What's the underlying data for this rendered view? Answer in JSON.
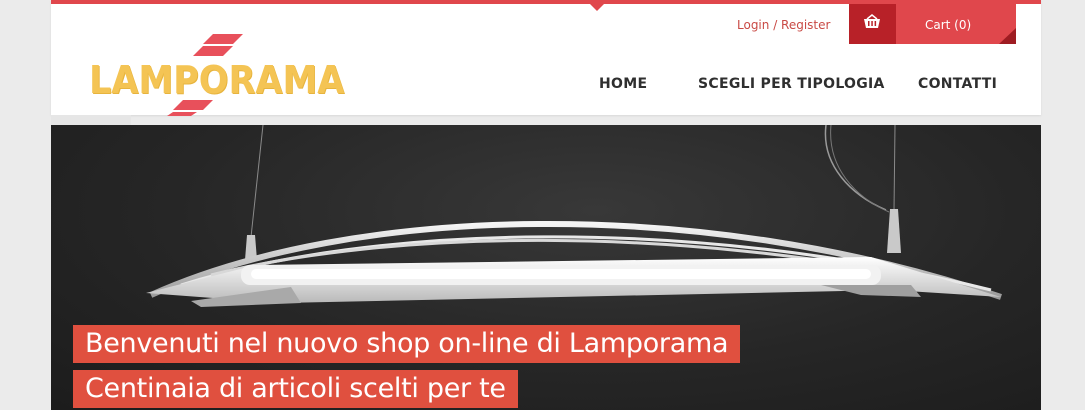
{
  "brand": {
    "logo_text": "LAMPORAMA"
  },
  "topbar": {
    "login_label": "Login",
    "separator": " / ",
    "register_label": "Register",
    "cart_label": "Cart (0)"
  },
  "nav": {
    "home": "HOME",
    "types": "SCEGLI PER TIPOLOGIA",
    "contacts": "CONTATTI"
  },
  "hero": {
    "caption_line1": "Benvenuti nel nuovo shop on-line di Lamporama",
    "caption_line2": "Centinaia di articoli scelti per te"
  },
  "colors": {
    "accent": "#e0474c",
    "accent_dark": "#b82128",
    "logo": "#f4c454",
    "caption_bg": "#e0503f"
  },
  "icons": [
    "basket-icon",
    "logo-bolt-icon"
  ]
}
